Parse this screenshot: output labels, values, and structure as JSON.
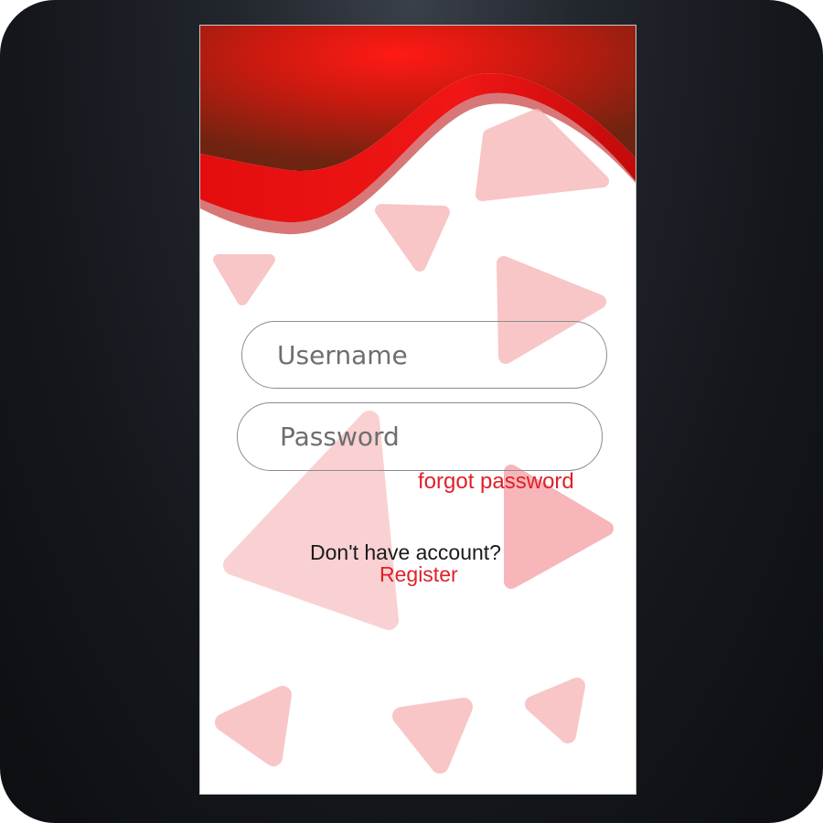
{
  "login": {
    "username_placeholder": "Username",
    "password_placeholder": "Password",
    "forgot_password": "forgot password",
    "no_account_text": "Don't have account?",
    "register_label": "Register"
  },
  "colors": {
    "accent": "#e0202a",
    "header_red": "#e51414",
    "header_dark": "#8a1d10",
    "decor_pink": "#f6b3b5"
  },
  "icons": [
    "triangle-decoration-icon"
  ]
}
